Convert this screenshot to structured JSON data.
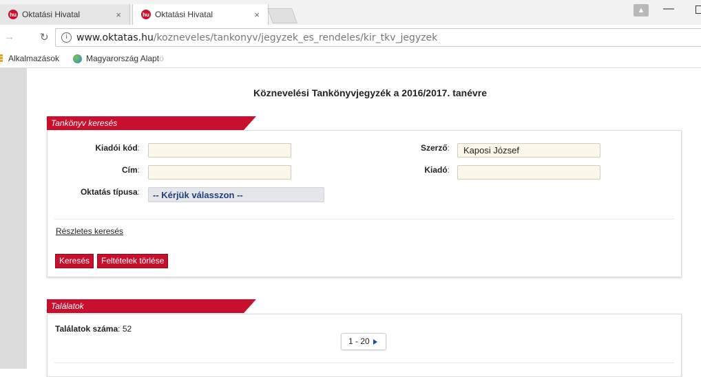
{
  "browser": {
    "tabs": [
      {
        "title": "Oktatási Hivatal",
        "favicon": "hu"
      },
      {
        "title": "Oktatási Hivatal",
        "favicon": "hu"
      }
    ],
    "close_glyph": "×",
    "url_host": "www.oktatas.hu",
    "url_path": "/kozneveles/tankonyv/jegyzek_es_rendeles/kir_tkv_jegyzek",
    "bookmarks": [
      {
        "label": "Alkalmazások"
      },
      {
        "label": "Magyarország Alaptö",
        "label_main": "Magyarország Alapt",
        "label_fade": "ö"
      }
    ]
  },
  "page": {
    "title": "Köznevelési Tankönyvjegyzék a 2016/2017. tanévre",
    "search": {
      "tab_label": "Tankönyv keresés",
      "fields": {
        "kiadoi_kod": {
          "label": "Kiadói kód",
          "value": ""
        },
        "cim": {
          "label": "Cím",
          "value": ""
        },
        "oktatas_tipusa": {
          "label": "Oktatás típusa",
          "value": "-- Kérjük válasszon --"
        },
        "szerzo": {
          "label": "Szerző",
          "value": "Kaposi József"
        },
        "kiado": {
          "label": "Kiadó",
          "value": ""
        }
      },
      "colon": ":",
      "advanced_link": "Részletes keresés",
      "buttons": {
        "search": "Keresés",
        "clear": "Feltételek törlése"
      }
    },
    "results": {
      "tab_label": "Találatok",
      "count_label": "Találatok száma",
      "count_value": ": 52",
      "pager_text": "1 - 20"
    }
  },
  "colors": {
    "accent": "#c8102e",
    "input_bg": "#fdf7ea",
    "select_text": "#1f3f7a"
  }
}
